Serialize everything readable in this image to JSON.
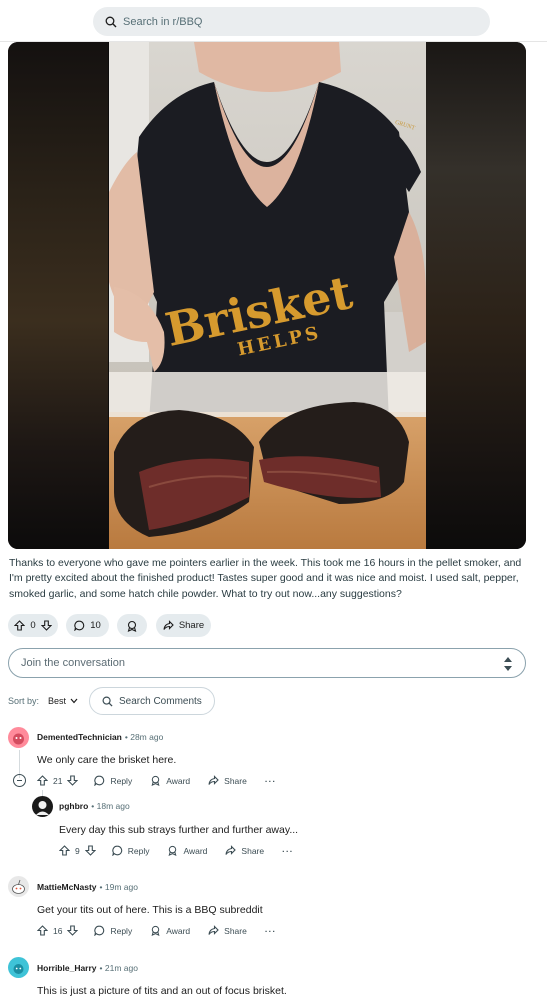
{
  "header": {
    "search_placeholder": "Search in r/BBQ"
  },
  "post": {
    "shirt_text_1": "Brisket",
    "shirt_text_2": "HELPS",
    "body": "Thanks to everyone who gave me pointers earlier in the week. This took me 16 hours in the pellet smoker, and I'm pretty excited about the finished product! Tastes super good and it was nice and moist. I used salt, pepper, smoked garlic, and some hatch chile powder. What to try out now...any suggestions?",
    "votes": "0",
    "comments": "10",
    "share_label": "Share"
  },
  "join": {
    "placeholder": "Join the conversation"
  },
  "sort": {
    "label": "Sort by:",
    "value": "Best",
    "search_placeholder": "Search Comments"
  },
  "comments": [
    {
      "user": "DementedTechnician",
      "time": "28m ago",
      "text": "We only care the brisket here.",
      "votes": "21",
      "reply": "Reply",
      "award": "Award",
      "share": "Share",
      "avatar_color": "#ff8b9b"
    },
    {
      "user": "pghbro",
      "time": "18m ago",
      "text": "Every day this sub strays further and further away...",
      "votes": "9",
      "reply": "Reply",
      "award": "Award",
      "share": "Share",
      "avatar_color": "#1a1a1a"
    },
    {
      "user": "MattieMcNasty",
      "time": "19m ago",
      "text": "Get your tits out of here. This is a BBQ subreddit",
      "votes": "16",
      "reply": "Reply",
      "award": "Award",
      "share": "Share",
      "avatar_color": "#e8e8e8"
    },
    {
      "user": "Horrible_Harry",
      "time": "21m ago",
      "text": "This is just a picture of tits and an out of focus brisket.",
      "avatar_color": "#3fc3d7"
    }
  ],
  "icons": {
    "search": "search-icon",
    "upvote": "upvote-icon",
    "downvote": "downvote-icon",
    "comment": "comment-icon",
    "award": "award-icon",
    "share": "share-icon",
    "more": "more-icon",
    "collapse": "collapse-icon"
  }
}
